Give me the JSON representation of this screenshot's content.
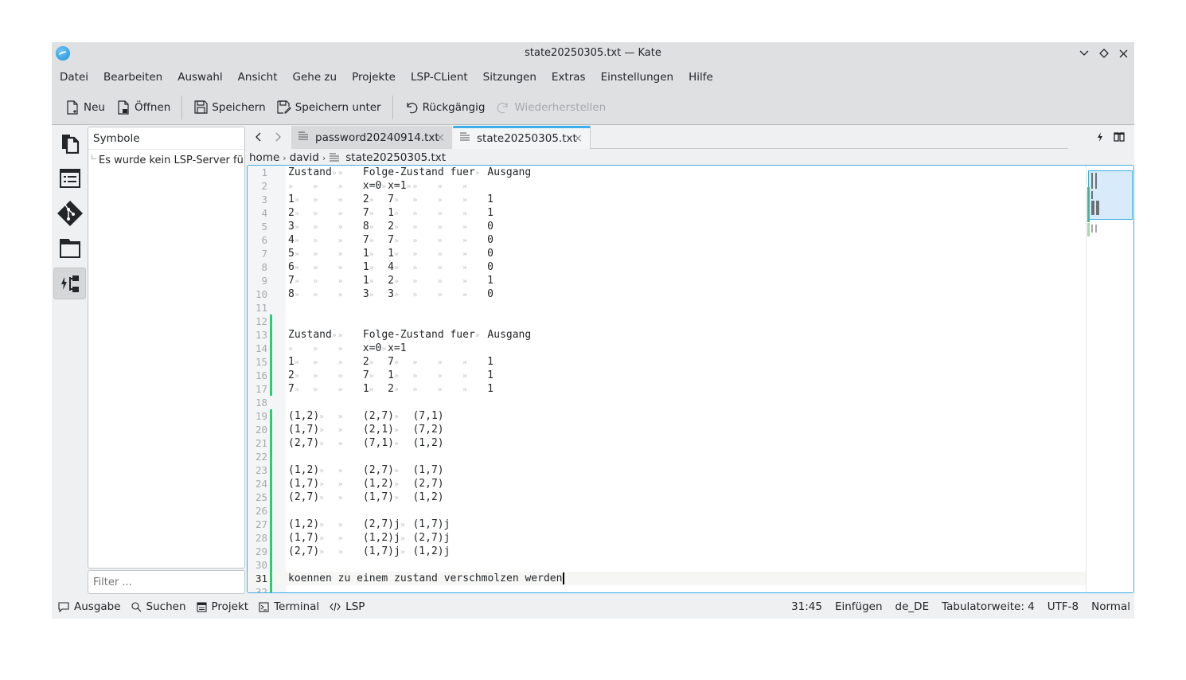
{
  "window": {
    "title": "state20250305.txt — Kate",
    "controls": [
      "minimize",
      "maximize",
      "close"
    ]
  },
  "menu": [
    "Datei",
    "Bearbeiten",
    "Auswahl",
    "Ansicht",
    "Gehe zu",
    "Projekte",
    "LSP-CLient",
    "Sitzungen",
    "Extras",
    "Einstellungen",
    "Hilfe"
  ],
  "toolbar": {
    "new_label": "Neu",
    "open_label": "Öffnen",
    "save_label": "Speichern",
    "save_as_label": "Speichern unter",
    "undo_label": "Rückgängig",
    "redo_label": "Wiederherstellen"
  },
  "sidebar": {
    "icons": [
      "documents-icon",
      "symbol-list-icon",
      "git-icon",
      "folder-icon",
      "lsp-symbols-icon"
    ],
    "active_index": 4,
    "panel_title": "Symbole",
    "panel_item": "Es wurde kein LSP-Server fü...",
    "filter_placeholder": "Filter ..."
  },
  "tabs": [
    {
      "label": "password20240914.txt",
      "active": false
    },
    {
      "label": "state20250305.txt",
      "active": true
    }
  ],
  "breadcrumb": {
    "parts": [
      "home",
      "david"
    ],
    "file": "state20250305.txt"
  },
  "editor": {
    "current_line": 31,
    "modified_ranges": [
      [
        12,
        17
      ],
      [
        19,
        32
      ]
    ],
    "lines": [
      "Zustand\t\tFolge-Zustand fuer\tAusgang",
      "\t\t\tx=0\tx=1\t\t\t\t",
      "1\t\t\t2\t7\t\t\t\t1",
      "2\t\t\t7\t1\t\t\t\t1",
      "3\t\t\t8\t2\t\t\t\t0",
      "4\t\t\t7\t7\t\t\t\t0",
      "5\t\t\t1\t1\t\t\t\t0",
      "6\t\t\t1\t4\t\t\t\t0",
      "7\t\t\t1\t2\t\t\t\t1",
      "8\t\t\t3\t3\t\t\t\t0",
      "",
      "",
      "Zustand\t\tFolge-Zustand fuer\tAusgang",
      "\t\t\tx=0\tx=1",
      "1\t\t\t2\t7\t\t\t\t1",
      "2\t\t\t7\t1\t\t\t\t1",
      "7\t\t\t1\t2\t\t\t\t1",
      "",
      "(1,2)\t\t(2,7)\t(7,1)",
      "(1,7)\t\t(2,1)\t(7,2)",
      "(2,7)\t\t(7,1)\t(1,2)",
      "",
      "(1,2)\t\t(2,7)\t(1,7)",
      "(1,7)\t\t(1,2)\t(2,7)",
      "(2,7)\t\t(1,7)\t(1,2)",
      "",
      "(1,2)\t\t(2,7)j\t(1,7)j",
      "(1,7)\t\t(1,2)j\t(2,7)j",
      "(2,7)\t\t(1,7)j\t(1,2)j",
      "",
      "koennen zu einem zustand verschmolzen werden",
      ""
    ]
  },
  "statusbar": {
    "left": [
      {
        "icon": "output-icon",
        "label": "Ausgabe"
      },
      {
        "icon": "search-icon",
        "label": "Suchen"
      },
      {
        "icon": "project-icon",
        "label": "Projekt"
      },
      {
        "icon": "terminal-icon",
        "label": "Terminal"
      },
      {
        "icon": "lsp-icon",
        "label": "LSP"
      }
    ],
    "cursor_position": "31:45",
    "input_mode": "Einfügen",
    "language": "de_DE",
    "tab_width": "Tabulatorweite: 4",
    "encoding": "UTF-8",
    "view_mode": "Normal"
  },
  "colors": {
    "accent": "#3daee9",
    "modified_marker": "#2ecc71",
    "chrome": "#dee0e2"
  }
}
